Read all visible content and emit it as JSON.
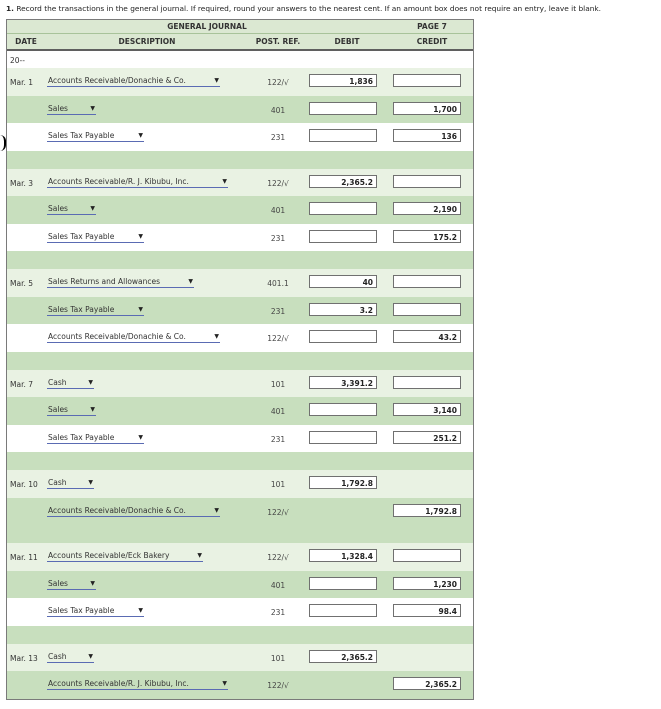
{
  "instructions": {
    "number": "1.",
    "text": "Record the transactions in the general journal. If required, round your answers to the nearest cent. If an amount box does not require an entry, leave it blank."
  },
  "journal": {
    "title": "GENERAL JOURNAL",
    "page": "PAGE 7",
    "columns": {
      "date": "DATE",
      "description": "DESCRIPTION",
      "post_ref": "POST. REF.",
      "debit": "DEBIT",
      "credit": "CREDIT"
    },
    "year": "20--",
    "entries": [
      {
        "date": "Mar. 1",
        "lines": [
          {
            "account": "Accounts Receivable/Donachie & Co.",
            "indent": false,
            "ref": "122/√",
            "debit": "1,836",
            "credit": "",
            "has_credit": true
          },
          {
            "account": "Sales",
            "indent": true,
            "ref": "401",
            "debit": "",
            "credit": "1,700",
            "has_debit": true
          },
          {
            "account": "Sales Tax Payable",
            "indent": true,
            "ref": "231",
            "debit": "",
            "credit": "136",
            "has_debit": true
          }
        ]
      },
      {
        "date": "Mar. 3",
        "lines": [
          {
            "account": "Accounts Receivable/R. J. Kibubu, Inc.",
            "indent": false,
            "ref": "122/√",
            "debit": "2,365.2",
            "credit": ""
          },
          {
            "account": "Sales",
            "indent": true,
            "ref": "401",
            "debit": "",
            "credit": "2,190"
          },
          {
            "account": "Sales Tax Payable",
            "indent": true,
            "ref": "231",
            "debit": "",
            "credit": "175.2"
          }
        ]
      },
      {
        "date": "Mar. 5",
        "lines": [
          {
            "account": "Sales Returns and Allowances",
            "indent": false,
            "ref": "401.1",
            "debit": "40",
            "credit": ""
          },
          {
            "account": "Sales Tax Payable",
            "indent": true,
            "ref": "231",
            "debit": "3.2",
            "credit": ""
          },
          {
            "account": "Accounts Receivable/Donachie & Co.",
            "indent": true,
            "ref": "122/√",
            "debit": "",
            "credit": "43.2"
          }
        ]
      },
      {
        "date": "Mar. 7",
        "lines": [
          {
            "account": "Cash",
            "indent": false,
            "ref": "101",
            "debit": "3,391.2",
            "credit": ""
          },
          {
            "account": "Sales",
            "indent": true,
            "ref": "401",
            "debit": "",
            "credit": "3,140"
          },
          {
            "account": "Sales Tax Payable",
            "indent": true,
            "ref": "231",
            "debit": "",
            "credit": "251.2"
          }
        ]
      },
      {
        "date": "Mar. 10",
        "lines": [
          {
            "account": "Cash",
            "indent": false,
            "ref": "101",
            "debit": "1,792.8",
            "credit": null
          },
          {
            "account": "Accounts Receivable/Donachie & Co.",
            "indent": true,
            "ref": "122/√",
            "debit": null,
            "credit": "1,792.8"
          }
        ]
      },
      {
        "date": "Mar. 11",
        "lines": [
          {
            "account": "Accounts Receivable/Eck Bakery",
            "indent": false,
            "ref": "122/√",
            "debit": "1,328.4",
            "credit": ""
          },
          {
            "account": "Sales",
            "indent": true,
            "ref": "401",
            "debit": "",
            "credit": "1,230"
          },
          {
            "account": "Sales Tax Payable",
            "indent": true,
            "ref": "231",
            "debit": "",
            "credit": "98.4"
          }
        ]
      },
      {
        "date": "Mar. 13",
        "lines": [
          {
            "account": "Cash",
            "indent": false,
            "ref": "101",
            "debit": "2,365.2",
            "credit": null
          },
          {
            "account": "Accounts Receivable/R. J. Kibubu, Inc.",
            "indent": true,
            "ref": "122/√",
            "debit": null,
            "credit": "2,365.2"
          }
        ]
      }
    ]
  },
  "icons": {
    "dropdown": "caret-down-icon"
  },
  "colors": {
    "header_bg": "#dbe8d2",
    "row_green": "#c8dfbe",
    "row_light": "#e9f2e3",
    "select_underline": "#5a6bb3"
  }
}
